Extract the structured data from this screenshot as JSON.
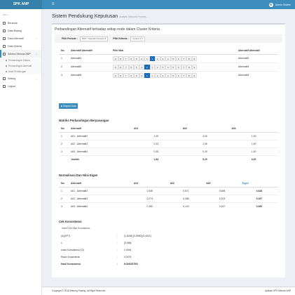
{
  "app": {
    "brand": "SPK ANP",
    "menu_icon": "≡",
    "user": "Admin Sistem"
  },
  "sidebar": {
    "header": "Menu",
    "items": [
      {
        "label": "Beranda",
        "icon": "home-icon"
      },
      {
        "label": "Data Bidang",
        "icon": "folder-icon"
      },
      {
        "label": "Data Alternatif",
        "icon": "list-icon",
        "arrow": "‹"
      },
      {
        "label": "Data Kriteria",
        "icon": "list-icon"
      },
      {
        "label": "Seleksi Metode ANP",
        "icon": "chart-icon",
        "arrow": "⌄",
        "active": true
      },
      {
        "label": "Setting",
        "icon": "gear-icon",
        "arrow": "‹"
      },
      {
        "label": "Logout",
        "icon": "power-icon"
      }
    ],
    "subitems": [
      "Perbandingan Kriteria",
      "Perbandingan Alternatif",
      "Hasil Perhitungan"
    ]
  },
  "page": {
    "title": "Sistem Pendukung Keputusan",
    "subtitle": "Analytic Network Process"
  },
  "box": {
    "title": "Perbandingan Alternatif terhadap setiap node dalam Cluster Kriteria",
    "filter": {
      "bidang_label": "Pilih Periode :",
      "bidang_value": "2015 - Sekolah Pertama",
      "kriteria_label": "Pilih Kriteria :",
      "kriteria_value": "Kriteria 1"
    }
  },
  "comparison": {
    "headers": [
      "No.",
      "Alternatif Alternatif",
      "Pilih Nilai",
      "Alternatif Alternatif"
    ],
    "scale": [
      "9",
      "8",
      "7",
      "6",
      "5",
      "4",
      "3",
      "1",
      "2",
      "3",
      "4",
      "5",
      "6",
      "7",
      "8",
      "9"
    ],
    "rows": [
      {
        "no": "1",
        "left": "Alternatif1",
        "selected": 7,
        "right": "Alternatif2"
      },
      {
        "no": "2",
        "left": "Alternatif2",
        "selected": 6,
        "right": "Alternatif4"
      },
      {
        "no": "3",
        "left": "Alternatif3",
        "selected": 6,
        "right": "Alternatif4"
      }
    ],
    "save_label": "Simpan Data"
  },
  "matrix": {
    "title": "Matriks Perbandingan Berpasangan",
    "headers": [
      "No.",
      "Alternatif",
      "A01",
      "A02",
      "A03"
    ],
    "rows": [
      [
        "1",
        "A01 - Alternatif2",
        "1,00",
        "3,00",
        "1,00"
      ],
      [
        "2",
        "A02 - Alternatif3",
        "0,33",
        "1,00",
        "1,00"
      ],
      [
        "3",
        "A03 - Alternatif4",
        "0,25",
        "0,20",
        "1,00"
      ]
    ],
    "total": [
      "",
      "Jumlah",
      "1,83",
      "5,20",
      "6,00"
    ]
  },
  "normal": {
    "title": "Normalisasi Dan Nilai Eigen",
    "headers": [
      "No.",
      "Alternatif",
      "A01",
      "A02",
      "A03",
      "Eigen"
    ],
    "rows": [
      [
        "1",
        "A01 - Alternatif2",
        "0,545",
        "0,571",
        "0,658",
        "0,628"
      ],
      [
        "2",
        "A02 - Alternatif3",
        "0,273",
        "0,286",
        "0,203",
        "0,297"
      ],
      [
        "3",
        "A03 - Alternatif4",
        "0,182",
        "0,143",
        "0,167",
        "0,069"
      ]
    ]
  },
  "consistency": {
    "title": "Cek Konsistensi",
    "subtitle": "Hasil Cek Nilai Konsistensi",
    "rows": [
      [
        "(A)(EPT)",
        ":",
        "[1,6248] [0,8960] [0,4021]"
      ],
      [
        "λ",
        ":",
        "[3,055]"
      ],
      [
        "Index Konsistensi (CI)",
        ":",
        "0,0044"
      ],
      [
        "Rasio Konsistensi",
        ":",
        "0,0076"
      ],
      [
        "Hasil Konsistensi",
        ":",
        "KONSISTEN"
      ]
    ]
  },
  "footer": {
    "left": "Copyright © 2018 Warung Pasting. All Right Reserved.",
    "right": "Aplikasi SPK Metode AHP"
  }
}
